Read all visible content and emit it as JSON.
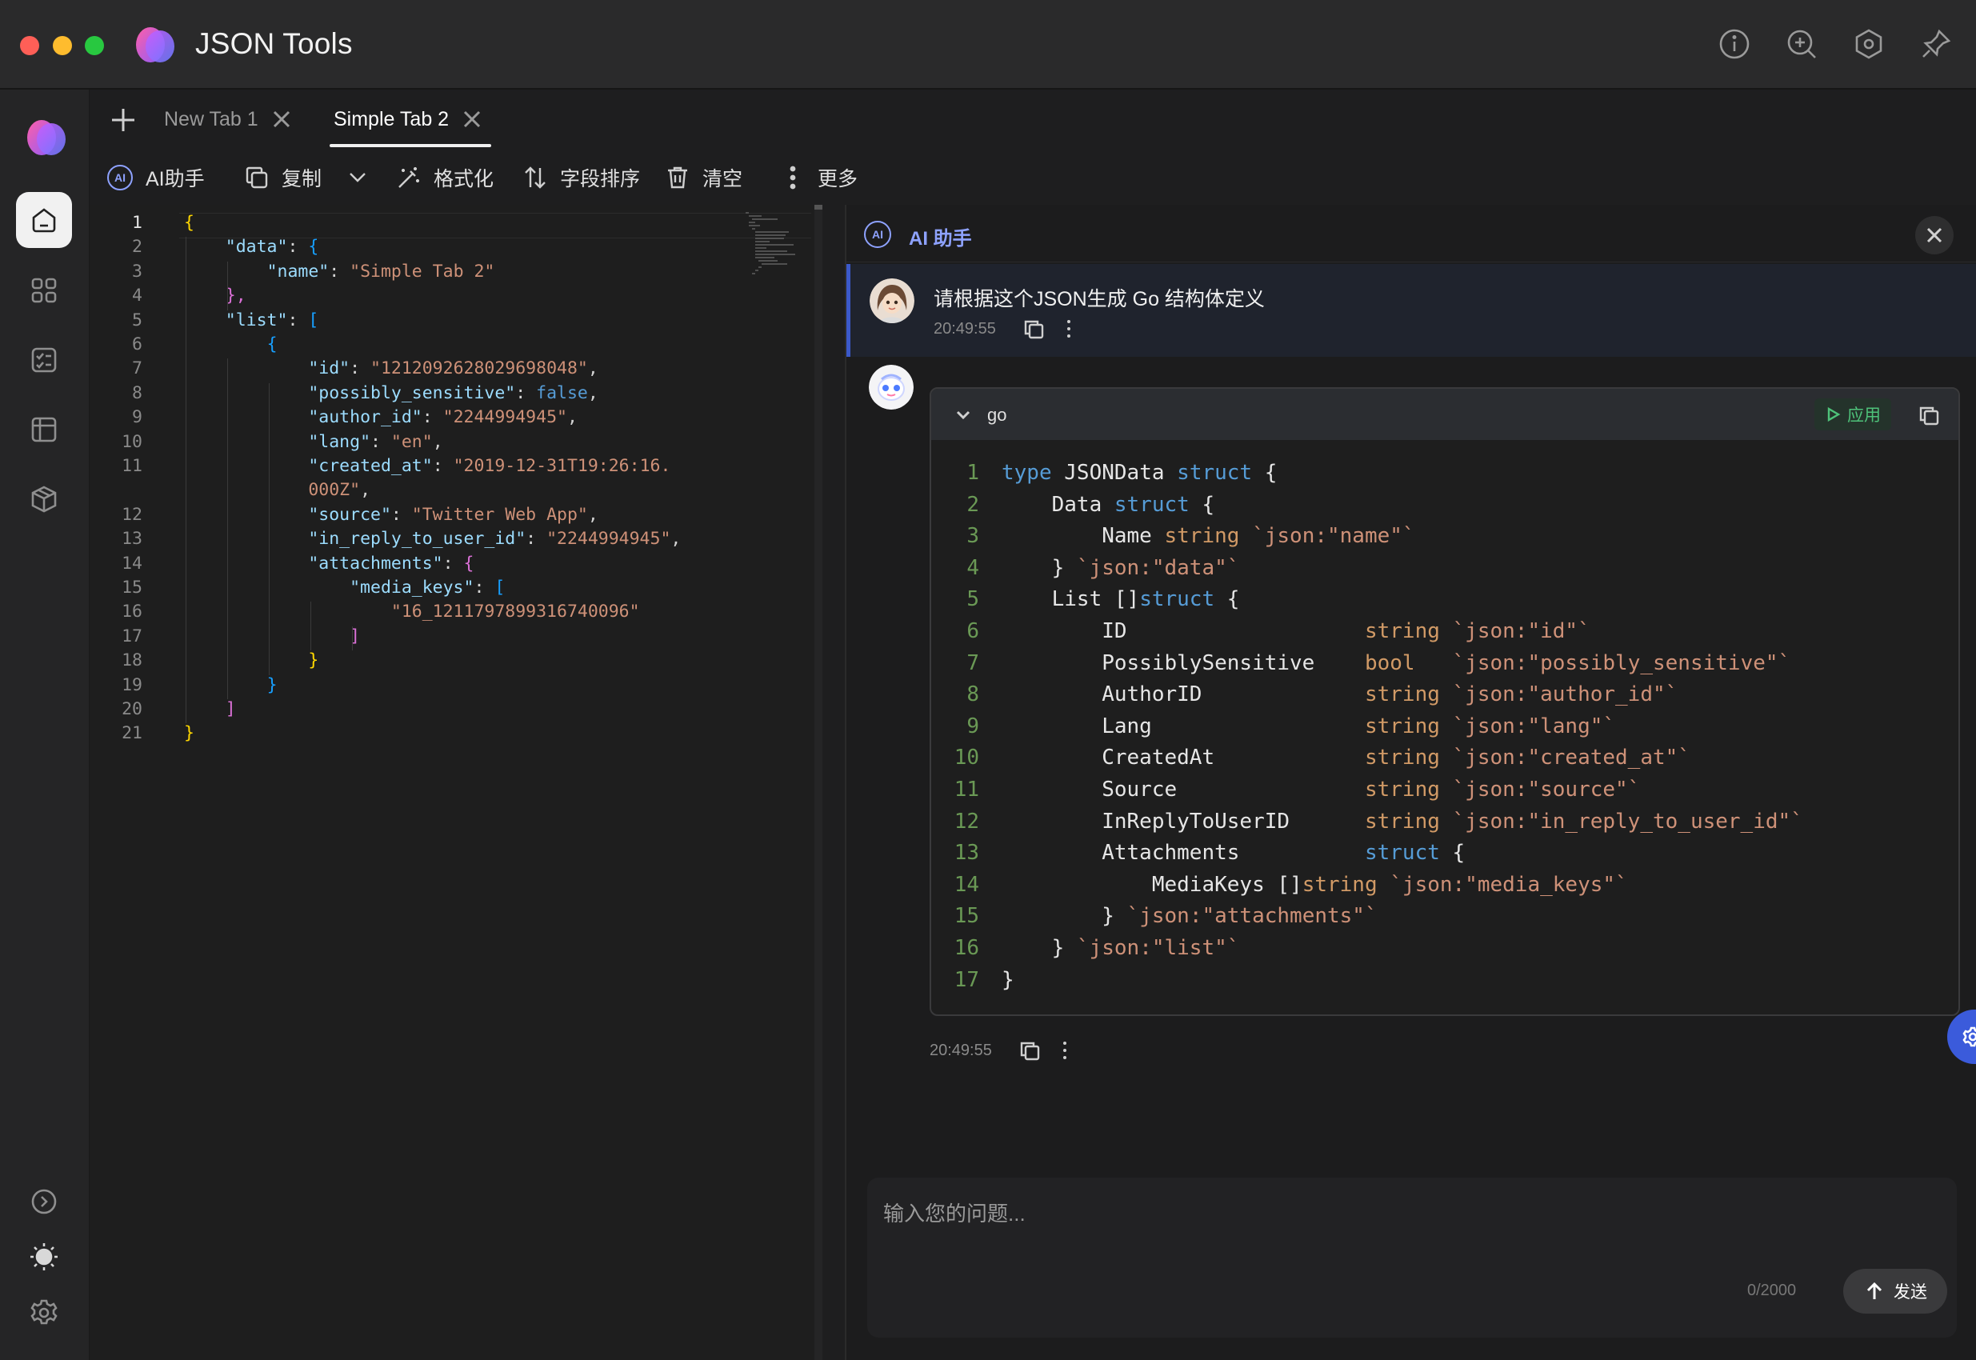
{
  "app": {
    "title": "JSON Tools",
    "accent": "#8ea2ff"
  },
  "titlebar_icons": [
    "info-icon",
    "zoom-in-icon",
    "settings-hex-icon",
    "pin-icon"
  ],
  "nav": {
    "items": [
      "home-icon",
      "apps-icon",
      "checklist-icon",
      "table-icon",
      "package-icon"
    ],
    "bottom": [
      "expand-icon",
      "theme-icon",
      "gear-icon"
    ]
  },
  "tabs": [
    {
      "label": "New Tab 1",
      "active": false
    },
    {
      "label": "Simple Tab 2",
      "active": true
    }
  ],
  "toolbar": {
    "ai": "AI助手",
    "ai_badge": "AI",
    "copy": "复制",
    "format": "格式化",
    "sort": "字段排序",
    "clear": "清空",
    "more": "更多"
  },
  "editor": {
    "line_numbers": [
      "1",
      "2",
      "3",
      "4",
      "5",
      "6",
      "7",
      "8",
      "9",
      "10",
      "11",
      "",
      "12",
      "13",
      "14",
      "15",
      "16",
      "17",
      "18",
      "19",
      "20",
      "21"
    ],
    "lines": [
      {
        "i": 0,
        "t": "{"
      },
      {
        "i": 1,
        "k": "\"data\"",
        "v": "{"
      },
      {
        "i": 2,
        "k": "\"name\"",
        "s": "\"Simple Tab 2\""
      },
      {
        "i": 1,
        "t": "},"
      },
      {
        "i": 1,
        "k": "\"list\"",
        "v": "["
      },
      {
        "i": 2,
        "t": "{"
      },
      {
        "i": 3,
        "k": "\"id\"",
        "s": "\"1212092628029698048\"",
        "c": ","
      },
      {
        "i": 3,
        "k": "\"possibly_sensitive\"",
        "bool": "false",
        "c": ","
      },
      {
        "i": 3,
        "k": "\"author_id\"",
        "s": "\"2244994945\"",
        "c": ","
      },
      {
        "i": 3,
        "k": "\"lang\"",
        "s": "\"en\"",
        "c": ","
      },
      {
        "i": 3,
        "k": "\"created_at\"",
        "s": "\"2019-12-31T19:26:16."
      },
      {
        "i": 3,
        "s2": "000Z\"",
        "c": ","
      },
      {
        "i": 3,
        "k": "\"source\"",
        "s": "\"Twitter Web App\"",
        "c": ","
      },
      {
        "i": 3,
        "k": "\"in_reply_to_user_id\"",
        "s": "\"2244994945\"",
        "c": ","
      },
      {
        "i": 3,
        "k": "\"attachments\"",
        "v": "{"
      },
      {
        "i": 4,
        "k": "\"media_keys\"",
        "v": "["
      },
      {
        "i": 5,
        "s2": "\"16_1211797899316740096\""
      },
      {
        "i": 4,
        "t": "]"
      },
      {
        "i": 3,
        "t": "}"
      },
      {
        "i": 2,
        "t": "}"
      },
      {
        "i": 1,
        "t": "]"
      },
      {
        "i": 0,
        "t": "}"
      }
    ]
  },
  "ai_panel": {
    "title": "AI 助手",
    "badge": "AI",
    "user_message": "请根据这个JSON生成 Go 结构体定义",
    "user_time": "20:49:55",
    "bot_time": "20:49:55",
    "code_lang": "go",
    "apply": "应用",
    "go_lines": [
      "type JSONData struct {",
      "    Data struct {",
      "        Name string `json:\"name\"`",
      "    } `json:\"data\"`",
      "    List []struct {",
      "        ID                   string `json:\"id\"`",
      "        PossiblySensitive    bool   `json:\"possibly_sensitive\"`",
      "        AuthorID             string `json:\"author_id\"`",
      "        Lang                 string `json:\"lang\"`",
      "        CreatedAt            string `json:\"created_at\"`",
      "        Source               string `json:\"source\"`",
      "        InReplyToUserID      string `json:\"in_reply_to_user_id\"`",
      "        Attachments          struct {",
      "            MediaKeys []string `json:\"media_keys\"`",
      "        } `json:\"attachments\"`",
      "    } `json:\"list\"`",
      "}"
    ],
    "input_placeholder": "输入您的问题...",
    "char_count": "0/2000",
    "send": "发送"
  }
}
